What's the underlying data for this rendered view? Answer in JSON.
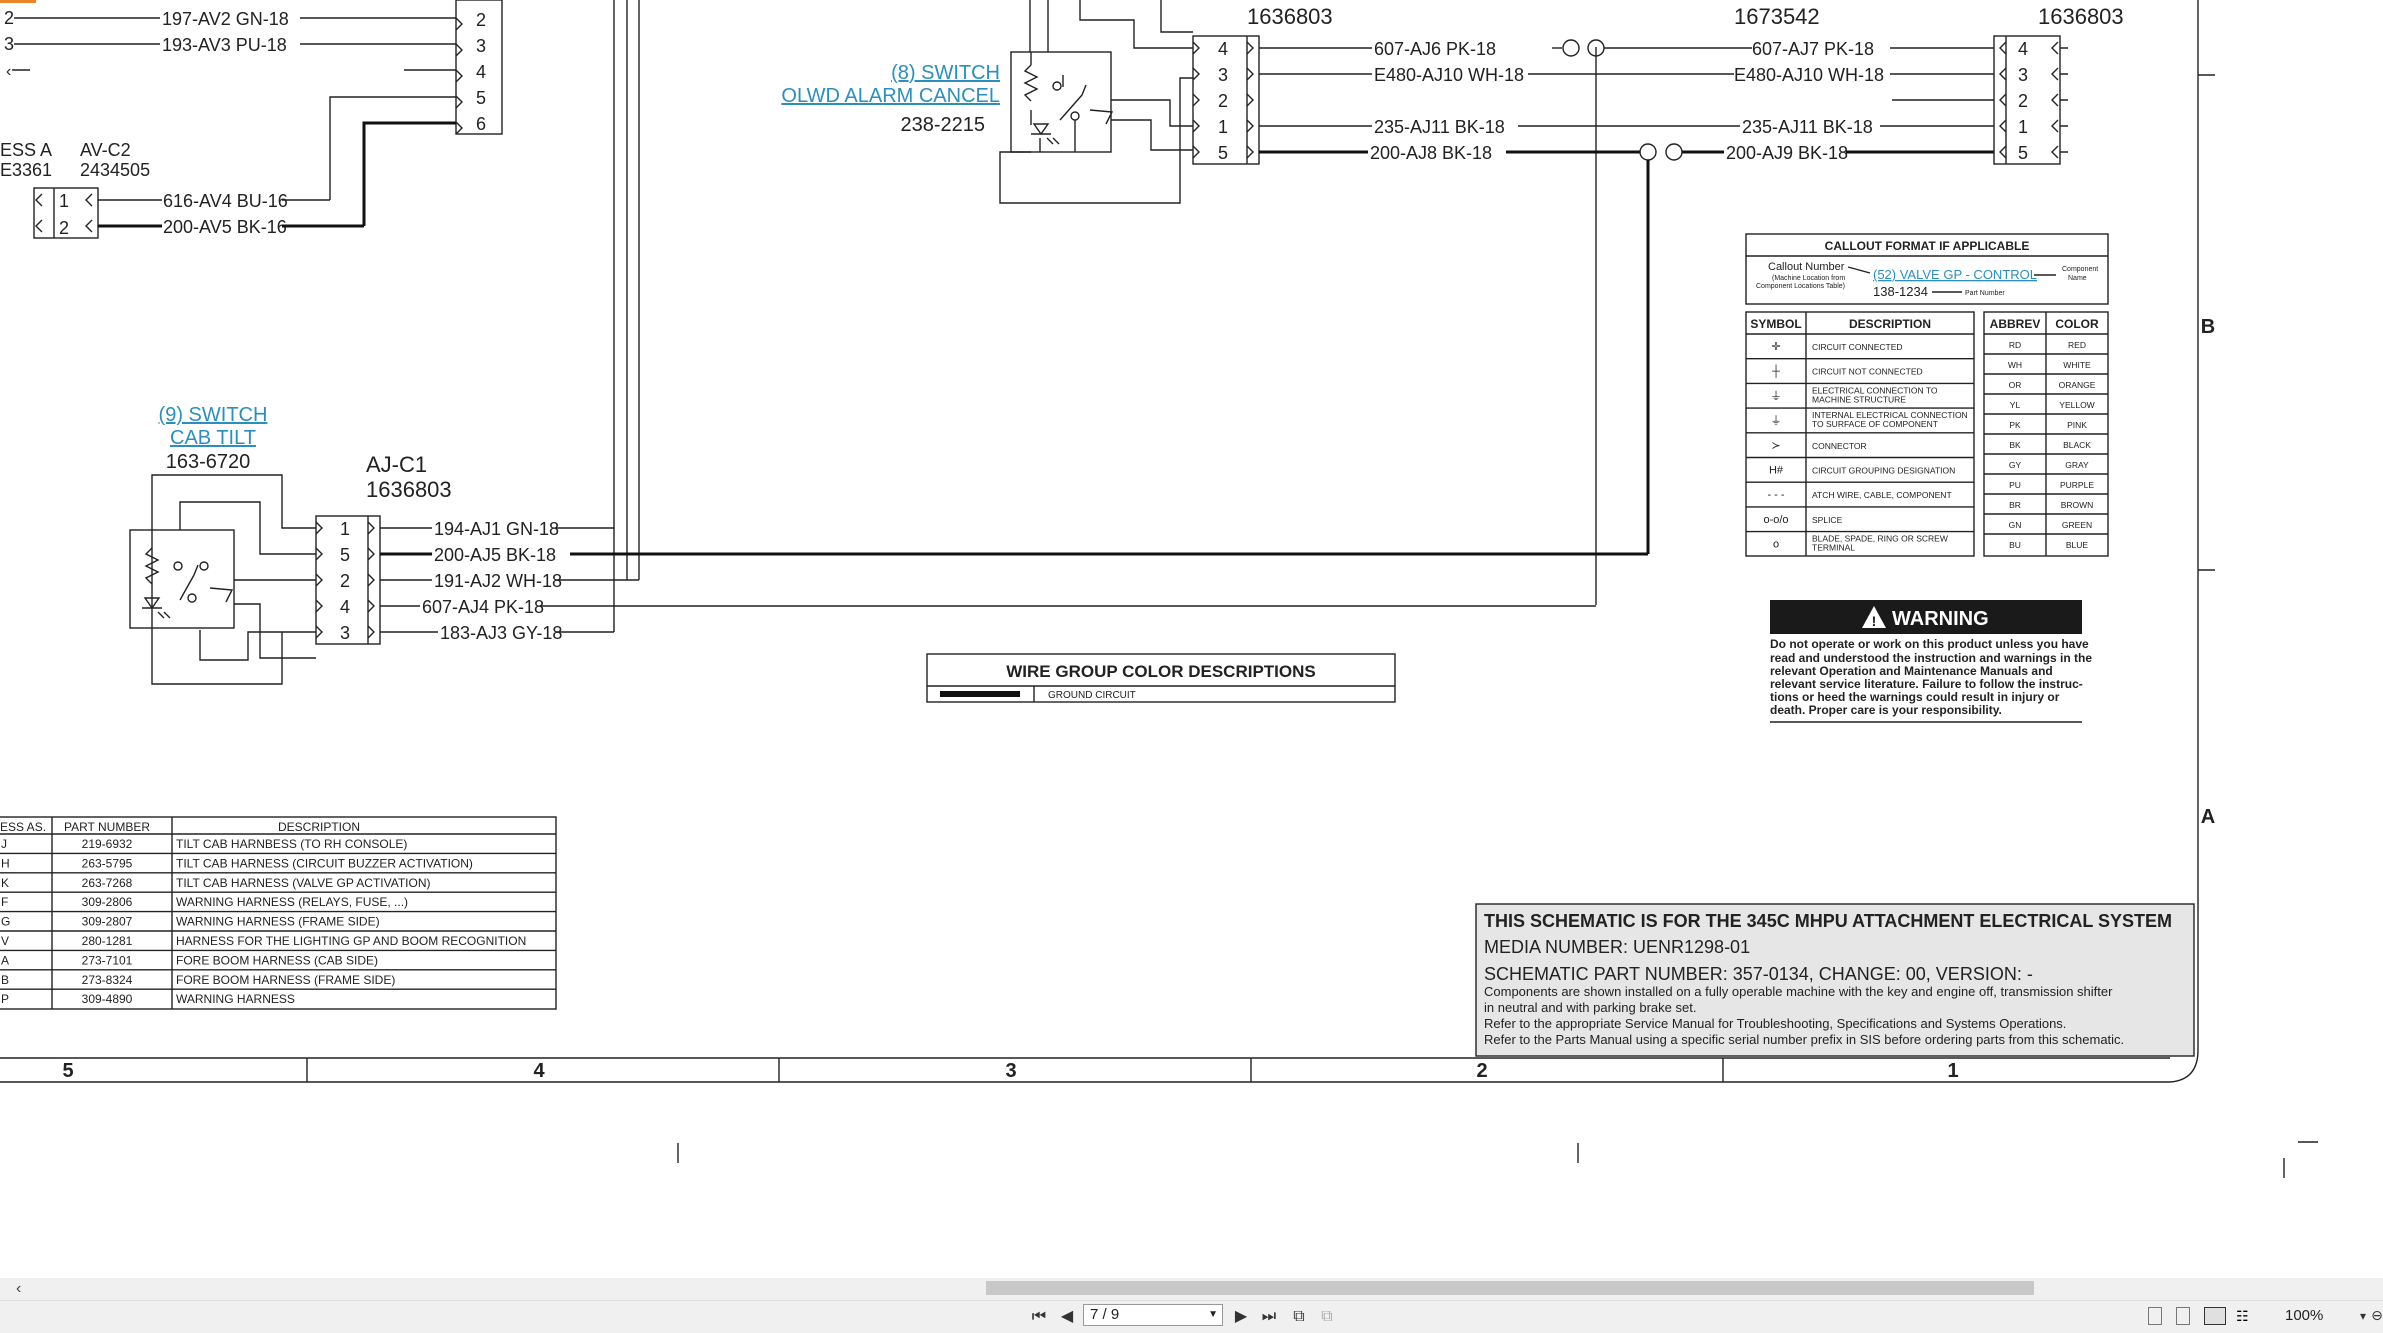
{
  "pager": {
    "page": "7 / 9",
    "zoom": "100%"
  },
  "top_left": {
    "wires": [
      "197-AV2 GN-18",
      "193-AV3 PU-18",
      "616-AV4 BU-16",
      "200-AV5 BK-16"
    ],
    "pins": [
      "2",
      "3",
      "4",
      "5",
      "6"
    ],
    "pins_small": [
      "1",
      "2"
    ],
    "harness_partial": "ESS A",
    "harness_partial_pn": "E3361",
    "conn_name": "AV-C2",
    "conn_pn": "2434505"
  },
  "switch8": {
    "line1": "(8) SWITCH",
    "line2": "OLWD ALARM CANCEL",
    "part": "238-2215",
    "conn_pn": "1636803",
    "pins": [
      "4",
      "3",
      "2",
      "1",
      "5"
    ]
  },
  "switch9": {
    "line1": "(9) SWITCH",
    "line2": "CAB TILT",
    "part": "163-6720",
    "conn_name": "AJ-C1",
    "conn_pn": "1636803",
    "pins": [
      "1",
      "5",
      "2",
      "4",
      "3"
    ],
    "wires": [
      "194-AJ1 GN-18",
      "200-AJ5 BK-18",
      "191-AJ2 WH-18",
      "607-AJ4 PK-18",
      "183-AJ3 GY-18"
    ]
  },
  "mid_wires": [
    "607-AJ6 PK-18",
    "E480-AJ10 WH-18",
    "235-AJ11 BK-18",
    "200-AJ8 BK-18"
  ],
  "right_conn": {
    "mid_pn": "1673542",
    "pn": "1636803",
    "pins": [
      "4",
      "3",
      "2",
      "1",
      "5"
    ],
    "wires": [
      "607-AJ7 PK-18",
      "E480-AJ10 WH-18",
      "235-AJ11 BK-18",
      "200-AJ9 BK-18"
    ]
  },
  "callout": {
    "title": "CALLOUT FORMAT IF APPLICABLE",
    "number_label": "Callout Number",
    "loc_note1": "(Machine Location from",
    "loc_note2": "Component Locations Table)",
    "example": "(52) VALVE GP - CONTROL",
    "comp_name1": "Component",
    "comp_name2": "Name",
    "part_example": "138-1234",
    "part_label": "Part Number"
  },
  "symbols": {
    "col1": "SYMBOL",
    "col2": "DESCRIPTION",
    "rows": [
      {
        "sym": "✛",
        "desc": [
          "CIRCUIT CONNECTED"
        ]
      },
      {
        "sym": "┼",
        "desc": [
          "CIRCUIT NOT CONNECTED"
        ]
      },
      {
        "sym": "⏚",
        "desc": [
          "ELECTRICAL CONNECTION TO",
          "MACHINE STRUCTURE"
        ]
      },
      {
        "sym": "⏚",
        "desc": [
          "INTERNAL ELECTRICAL CONNECTION",
          "TO SURFACE OF COMPONENT"
        ]
      },
      {
        "sym": "≻",
        "desc": [
          "CONNECTOR"
        ]
      },
      {
        "sym": "H#",
        "desc": [
          "CIRCUIT GROUPING DESIGNATION"
        ]
      },
      {
        "sym": "- - -",
        "desc": [
          "ATCH WIRE, CABLE, COMPONENT"
        ]
      },
      {
        "sym": "o-o/o",
        "desc": [
          "SPLICE"
        ]
      },
      {
        "sym": "o",
        "desc": [
          "BLADE, SPADE, RING OR SCREW",
          "TERMINAL"
        ]
      }
    ]
  },
  "colors": {
    "col1": "ABBREV",
    "col2": "COLOR",
    "rows": [
      [
        "RD",
        "RED"
      ],
      [
        "WH",
        "WHITE"
      ],
      [
        "OR",
        "ORANGE"
      ],
      [
        "YL",
        "YELLOW"
      ],
      [
        "PK",
        "PINK"
      ],
      [
        "BK",
        "BLACK"
      ],
      [
        "GY",
        "GRAY"
      ],
      [
        "PU",
        "PURPLE"
      ],
      [
        "BR",
        "BROWN"
      ],
      [
        "GN",
        "GREEN"
      ],
      [
        "BU",
        "BLUE"
      ]
    ]
  },
  "warning": {
    "title": "WARNING",
    "lines": [
      "Do not operate or work on this product unless you have",
      "read and understood the instruction and warnings in the",
      "relevant Operation and Maintenance Manuals and",
      "relevant service literature. Failure to follow the instruc-",
      "tions or heed the warnings could result in injury or",
      "death. Proper care is your responsibility."
    ]
  },
  "wire_group": {
    "title": "WIRE GROUP COLOR DESCRIPTIONS",
    "item": "GROUND CIRCUIT"
  },
  "harness_table": {
    "headers": [
      "ESS AS.",
      "PART NUMBER",
      "DESCRIPTION"
    ],
    "rows": [
      [
        "J",
        "219-6932",
        "TILT CAB HARNBESS (TO RH CONSOLE)"
      ],
      [
        "H",
        "263-5795",
        "TILT CAB HARNESS (CIRCUIT BUZZER ACTIVATION)"
      ],
      [
        "K",
        "263-7268",
        "TILT CAB HARNESS (VALVE GP ACTIVATION)"
      ],
      [
        "F",
        "309-2806",
        "WARNING HARNESS (RELAYS, FUSE, ...)"
      ],
      [
        "G",
        "309-2807",
        "WARNING HARNESS (FRAME SIDE)"
      ],
      [
        "V",
        "280-1281",
        "HARNESS FOR THE LIGHTING GP AND BOOM RECOGNITION"
      ],
      [
        "A",
        "273-7101",
        "FORE BOOM HARNESS (CAB SIDE)"
      ],
      [
        "B",
        "273-8324",
        "FORE BOOM HARNESS (FRAME SIDE)"
      ],
      [
        "P",
        "309-4890",
        "WARNING HARNESS"
      ]
    ]
  },
  "title_block": {
    "title": "THIS SCHEMATIC IS FOR THE 345C MHPU ATTACHMENT ELECTRICAL SYSTEM",
    "media": "MEDIA NUMBER: UENR1298-01",
    "part": "SCHEMATIC PART NUMBER: 357-0134, CHANGE: 00, VERSION: -",
    "notes": [
      "Components are shown installed on a fully operable machine with the key and engine off, transmission shifter",
      "in neutral and with parking brake set.",
      "Refer to the appropriate Service Manual for Troubleshooting, Specifications and Systems Operations.",
      "Refer to the Parts Manual using a specific serial number prefix in SIS before ordering parts from this schematic."
    ]
  },
  "zones": {
    "cols": [
      "5",
      "4",
      "3",
      "2",
      "1"
    ],
    "rows": [
      "B",
      "A"
    ]
  }
}
